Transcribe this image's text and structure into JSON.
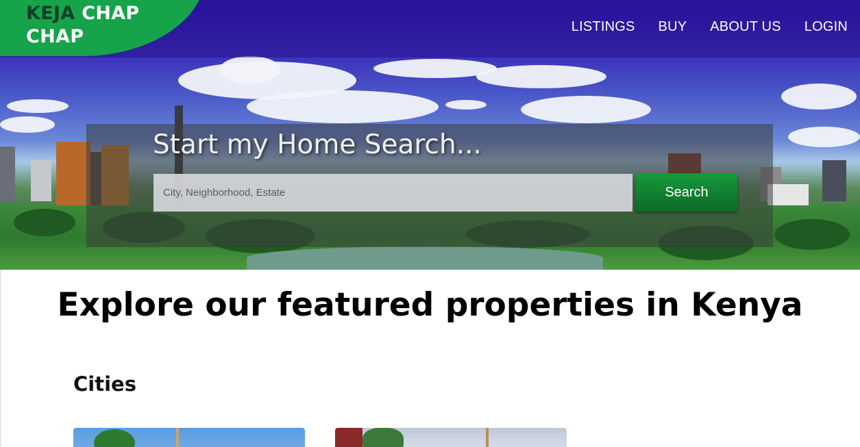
{
  "brand": {
    "logo_line1_dark": "KEJA",
    "logo_line1_light": "CHAP",
    "logo_line2": "CHAP",
    "accent_color": "#17a34a"
  },
  "nav": {
    "items": [
      "LISTINGS",
      "BUY",
      "ABOUT US",
      "LOGIN"
    ]
  },
  "hero": {
    "title": "Start my Home Search...",
    "search_placeholder": "City, Neighborhood, Estate",
    "search_button_label": "Search",
    "background_description_icon": "nairobi-skyline-image"
  },
  "main": {
    "heading": "Explore our featured properties in Kenya",
    "cities_heading": "Cities",
    "city_cards": [
      {
        "image_icon": "city-photo-1"
      },
      {
        "image_icon": "city-photo-2"
      }
    ]
  }
}
